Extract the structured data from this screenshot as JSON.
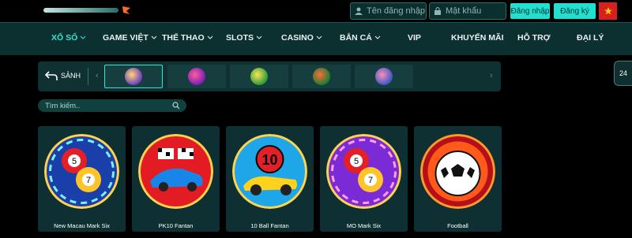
{
  "header": {
    "username_placeholder": "Tên đăng nhập",
    "password_placeholder": "Mật khẩu",
    "login_label": "Đăng nhập",
    "register_label": "Đăng ký",
    "language_flag": "vietnam-flag-icon"
  },
  "nav": {
    "items": [
      {
        "label": "XỔ SỐ",
        "dropdown": true,
        "active": true
      },
      {
        "label": "GAME VIỆT",
        "dropdown": true
      },
      {
        "label": "THỂ THAO",
        "dropdown": true
      },
      {
        "label": "SLOTS",
        "dropdown": true
      },
      {
        "label": "CASINO",
        "dropdown": true
      },
      {
        "label": "BẮN CÁ",
        "dropdown": true
      },
      {
        "label": "VIP",
        "dropdown": false
      },
      {
        "label": "KHUYẾN MÃI",
        "dropdown": false
      },
      {
        "label": "HỖ TRỢ",
        "dropdown": false
      },
      {
        "label": "ĐẠI LÝ",
        "dropdown": false
      }
    ]
  },
  "providers": {
    "lobby_label": "SẢNH",
    "prev_arrow": "‹",
    "next_arrow": "›",
    "items": [
      {
        "name": "provider-tp",
        "active": true
      },
      {
        "name": "provider-bbh"
      },
      {
        "name": "provider-lode"
      },
      {
        "name": "provider-saba"
      },
      {
        "name": "provider-gaming"
      }
    ]
  },
  "side_widget": {
    "label": "24"
  },
  "search": {
    "placeholder": "Tìm kiếm.."
  },
  "games": [
    {
      "title": "New Macau Mark Six"
    },
    {
      "title": "PK10 Fantan"
    },
    {
      "title": "10 Ball Fantan"
    },
    {
      "title": "MO Mark Six"
    },
    {
      "title": "Football"
    }
  ],
  "colors": {
    "accent": "#2ce6d6",
    "nav_bg": "#0c2f30",
    "card_bg": "#0e3032",
    "button_bg": "#22e0d0"
  }
}
